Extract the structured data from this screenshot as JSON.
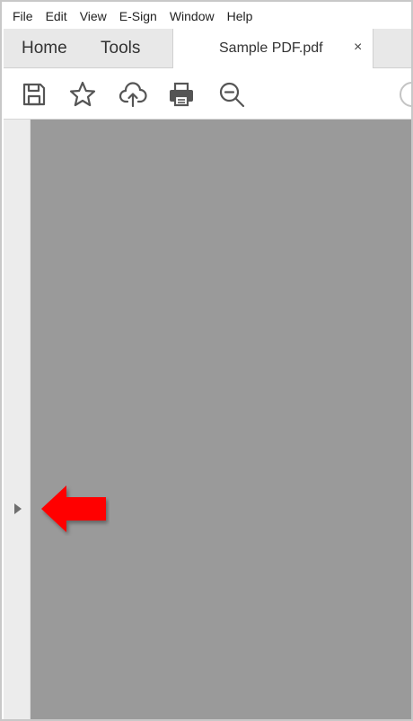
{
  "menubar": {
    "items": [
      {
        "label": "File"
      },
      {
        "label": "Edit"
      },
      {
        "label": "View"
      },
      {
        "label": "E-Sign"
      },
      {
        "label": "Window"
      },
      {
        "label": "Help"
      }
    ]
  },
  "tabs": {
    "home": "Home",
    "tools": "Tools",
    "document": {
      "title": "Sample PDF.pdf",
      "close": "×"
    }
  },
  "toolbar": {
    "icons": [
      "save-icon",
      "star-icon",
      "cloud-upload-icon",
      "print-icon",
      "zoom-out-icon",
      "more-icon"
    ]
  },
  "annotation": {
    "color": "#ff0000"
  },
  "colors": {
    "viewer_background": "#9a9a9a",
    "rail_background": "#ececec",
    "tabbar_background": "#e8e8e8"
  }
}
